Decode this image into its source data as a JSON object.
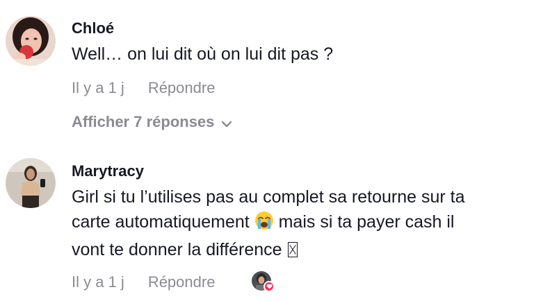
{
  "comments": [
    {
      "username": "Chloé",
      "text_lines": [
        "Well… on lui dit où on lui dit pas ?"
      ],
      "timestamp": "Il y a 1 j",
      "reply_label": "Répondre",
      "avatar_icon": "user-avatar-photo"
    },
    {
      "username": "Marytracy",
      "text_lines": [
        "Girl si tu l’utilises pas au complet sa retourne sur ta",
        "carte automatiquement",
        "mais si ta payer cash il",
        "vont te donner la différence"
      ],
      "timestamp": "Il y a 1 j",
      "reply_label": "Répondre",
      "avatar_icon": "user-avatar-photo",
      "emoji_icon": "loudly-crying-face-emoji",
      "missing_glyph_icon": "missing-glyph-box",
      "creator_liked_icon": "creator-liked-heart-icon"
    }
  ],
  "view_replies": {
    "label": "Afficher 7 réponses",
    "icon": "chevron-down-icon"
  },
  "colors": {
    "text": "#161823",
    "muted": "#8a8b91",
    "like_badge": "#fe2c55"
  }
}
